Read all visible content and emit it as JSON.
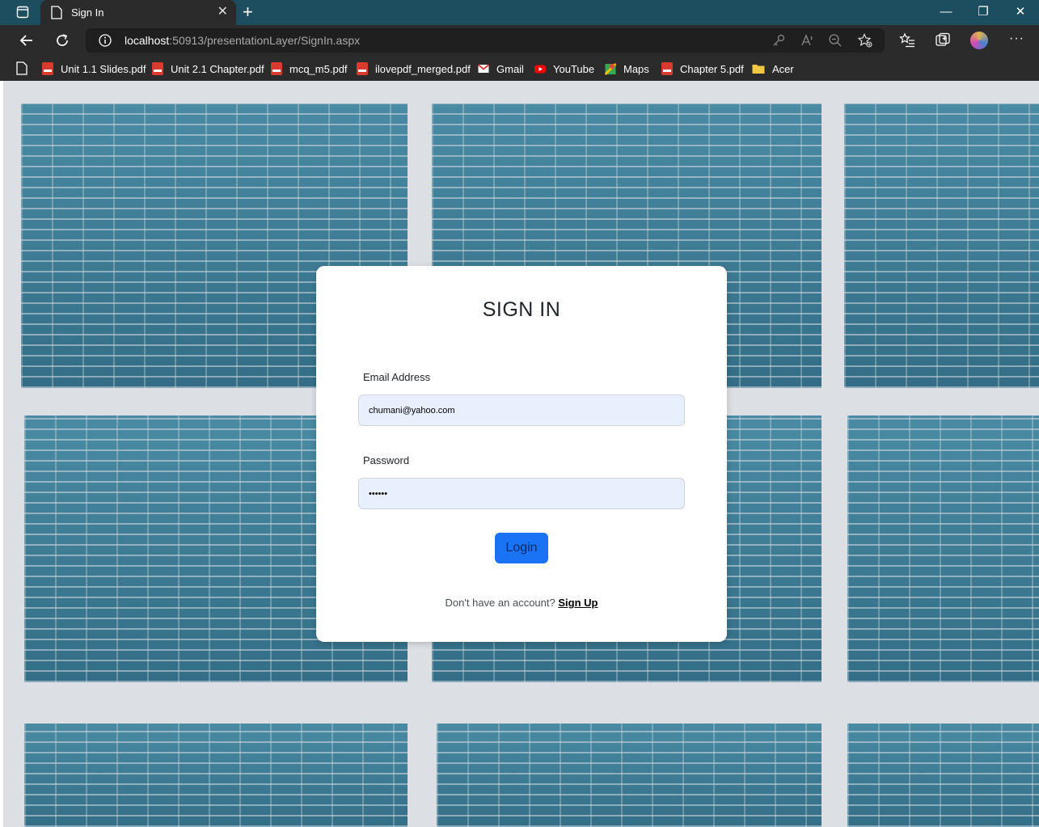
{
  "browser": {
    "tab_title": "Sign In",
    "tab_close": "✕",
    "new_tab": "+",
    "url_host": "localhost",
    "url_rest": ":50913/presentationLayer/SignIn.aspx",
    "window_controls": {
      "minimize": "—",
      "restore": "❐",
      "close": "✕"
    },
    "more_menu": "···"
  },
  "bookmarks": [
    {
      "label": "Unit 1.1 Slides.pdf",
      "icon": "pdf-icon"
    },
    {
      "label": "Unit 2.1 Chapter.pdf",
      "icon": "pdf-icon"
    },
    {
      "label": "mcq_m5.pdf",
      "icon": "pdf-icon"
    },
    {
      "label": "ilovepdf_merged.pdf",
      "icon": "pdf-icon"
    },
    {
      "label": "Gmail",
      "icon": "gmail-icon"
    },
    {
      "label": "YouTube",
      "icon": "youtube-icon"
    },
    {
      "label": "Maps",
      "icon": "maps-icon"
    },
    {
      "label": "Chapter 5.pdf",
      "icon": "pdf-icon"
    },
    {
      "label": "Acer",
      "icon": "folder-icon"
    }
  ],
  "form": {
    "title": "SIGN IN",
    "email_label": "Email Address",
    "email_value": "chumani@yahoo.com",
    "password_label": "Password",
    "password_value": "••••••",
    "login_label": "Login",
    "signup_prompt": "Don't have an account? ",
    "signup_link": "Sign Up"
  },
  "colors": {
    "titlebar": "#1d4e5f",
    "toolbar": "#2b2b2b",
    "brick": "#3f7f99",
    "mortar": "#dcdfe3",
    "login_button": "#1a73f5",
    "input_bg": "#e8f0fe"
  }
}
